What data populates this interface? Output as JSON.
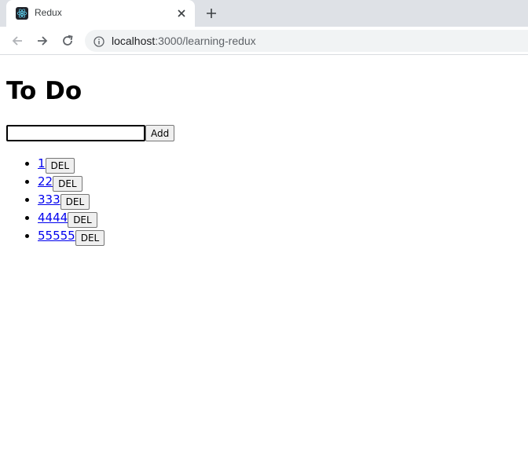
{
  "browser": {
    "tab": {
      "title": "Redux",
      "favicon": "react-icon"
    },
    "address": {
      "host": "localhost",
      "rest": ":3000/learning-redux"
    }
  },
  "page": {
    "title": "To Do",
    "form": {
      "input_value": "",
      "add_label": "Add"
    },
    "todos": [
      {
        "text": "1",
        "del_label": "DEL"
      },
      {
        "text": "22",
        "del_label": "DEL"
      },
      {
        "text": "333",
        "del_label": "DEL"
      },
      {
        "text": "4444",
        "del_label": "DEL"
      },
      {
        "text": "55555",
        "del_label": "DEL"
      }
    ]
  }
}
